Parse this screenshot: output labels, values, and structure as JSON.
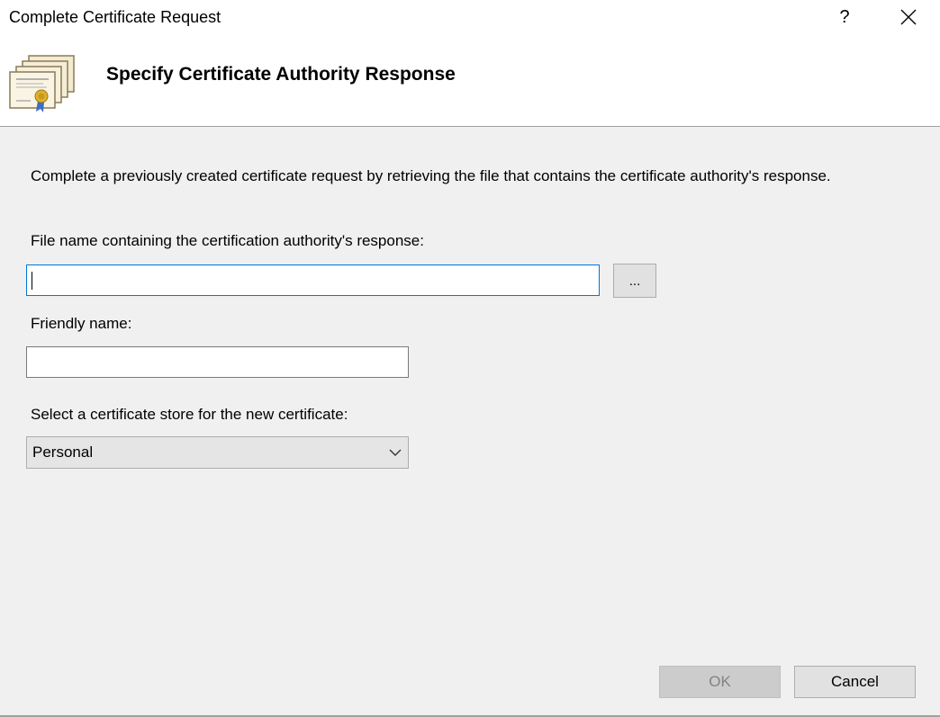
{
  "window": {
    "title": "Complete Certificate Request",
    "help_label": "?",
    "close_icon": "close-icon"
  },
  "header": {
    "icon": "certificate-icon",
    "title": "Specify Certificate Authority Response"
  },
  "body": {
    "description": "Complete a previously created certificate request by retrieving the file that contains the certificate authority's response.",
    "file_label": "File name containing the certification authority's response:",
    "file_value": "",
    "browse_label": "...",
    "friendly_label": "Friendly name:",
    "friendly_value": "",
    "store_label": "Select a certificate store for the new certificate:",
    "store_selected": "Personal"
  },
  "footer": {
    "ok_label": "OK",
    "cancel_label": "Cancel"
  },
  "colors": {
    "focus_border": "#0078d7",
    "dialog_bg": "#f0f0f0",
    "header_bg": "#ffffff"
  }
}
